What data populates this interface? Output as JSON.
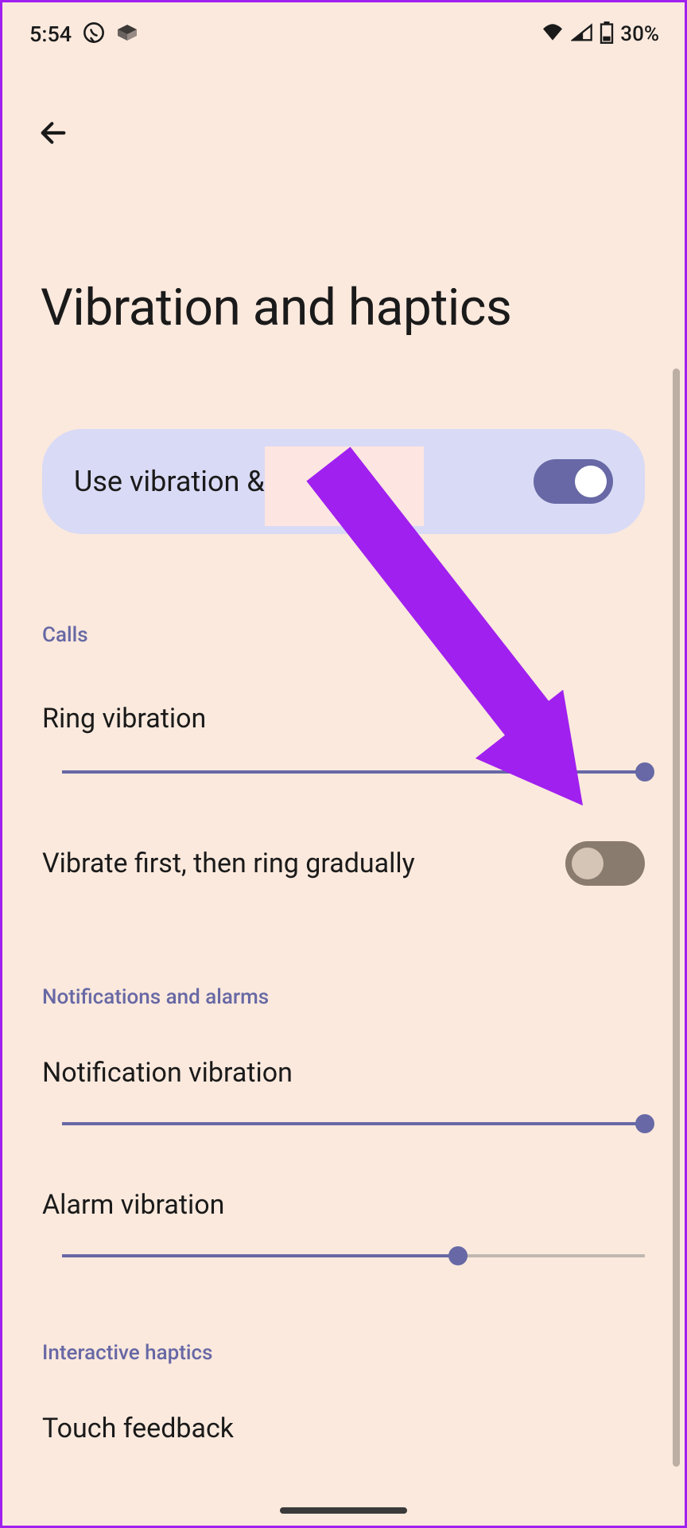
{
  "statusBar": {
    "time": "5:54",
    "batteryText": "30%"
  },
  "pageTitle": "Vibration and haptics",
  "mainToggle": {
    "label": "Use vibration & haptics",
    "enabled": true
  },
  "sections": {
    "calls": {
      "header": "Calls",
      "ringVibration": {
        "label": "Ring vibration",
        "sliderValue": 100
      },
      "vibrateFirst": {
        "label": "Vibrate first, then ring gradually",
        "enabled": false
      }
    },
    "notifications": {
      "header": "Notifications and alarms",
      "notificationVibration": {
        "label": "Notification vibration",
        "sliderValue": 100
      },
      "alarmVibration": {
        "label": "Alarm vibration",
        "sliderValue": 68
      }
    },
    "interactive": {
      "header": "Interactive haptics",
      "touchFeedback": {
        "label": "Touch feedback"
      }
    }
  }
}
